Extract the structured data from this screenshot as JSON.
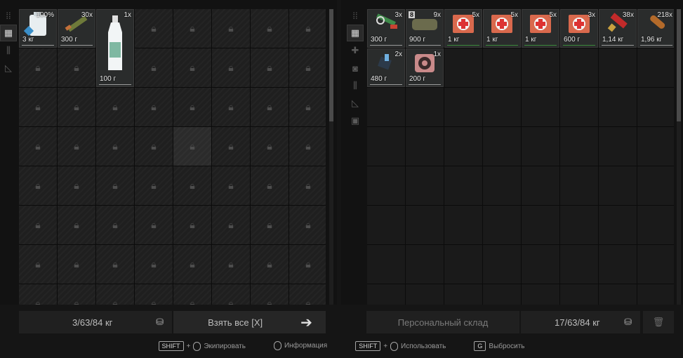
{
  "left_storage": {
    "items": [
      {
        "name": "water-canister",
        "count": "100%",
        "weight": "3 кг",
        "icon": "canister-icon"
      },
      {
        "name": "ammo-box",
        "count": "30x",
        "weight": "300 г",
        "icon": "ammo-icon"
      },
      {
        "name": "bottle",
        "count": "1x",
        "weight": "100 г",
        "icon": "bottle-icon"
      }
    ],
    "capacity": "3/63/84 кг",
    "take_all_label": "Взять все [X]"
  },
  "right_storage": {
    "items": [
      {
        "name": "weapon-kit",
        "count": "3x",
        "weight": "300 г",
        "icon": "kit-icon"
      },
      {
        "name": "fabric-roll",
        "count": "9x",
        "weight": "900 г",
        "badge": "8",
        "icon": "fabric-icon"
      },
      {
        "name": "medkit-1",
        "count": "5x",
        "weight": "1 кг",
        "icon": "medkit-icon"
      },
      {
        "name": "medkit-2",
        "count": "5x",
        "weight": "1 кг",
        "icon": "medkit-icon"
      },
      {
        "name": "medkit-3",
        "count": "5x",
        "weight": "1 кг",
        "icon": "medkit-icon"
      },
      {
        "name": "medkit-4",
        "count": "3x",
        "weight": "600 г",
        "icon": "medkit-icon"
      },
      {
        "name": "shotgun-shells",
        "count": "38x",
        "weight": "1,14 кг",
        "icon": "shell-icon"
      },
      {
        "name": "rifle-ammo",
        "count": "218x",
        "weight": "1,96 кг",
        "icon": "bullet-icon"
      },
      {
        "name": "tool-pack",
        "count": "2x",
        "weight": "480 г",
        "icon": "tool-icon"
      },
      {
        "name": "tape-roll",
        "count": "1x",
        "weight": "200 г",
        "icon": "tape-icon"
      }
    ],
    "title_label": "Персональный склад",
    "capacity": "17/63/84 кг"
  },
  "hints": [
    {
      "key": "SHIFT",
      "plus": "+",
      "label": "Экипировать"
    },
    {
      "key": "",
      "plus": "",
      "label": "Информация"
    },
    {
      "key": "SHIFT",
      "plus": "+",
      "label": "Использовать"
    },
    {
      "key": "G",
      "plus": "",
      "label": "Выбросить"
    }
  ]
}
